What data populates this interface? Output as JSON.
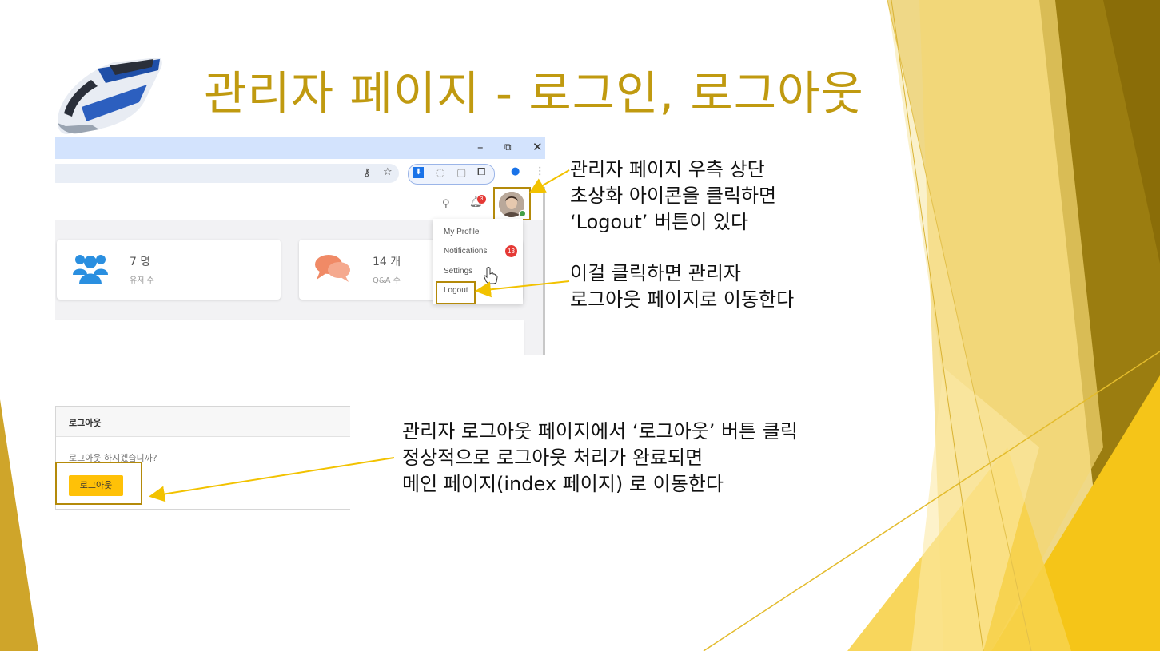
{
  "slide": {
    "title": "관리자 페이지 - 로그인, 로그아웃",
    "accent": "#c09a10"
  },
  "shot1": {
    "window_controls": {
      "minimize": "–",
      "restore": "⧉",
      "close": "✕"
    },
    "cards": [
      {
        "value": "7 명",
        "label": "유저 수",
        "icon": "users-icon",
        "color": "#2a8fe0"
      },
      {
        "value": "14 개",
        "label": "Q&A 수",
        "icon": "chat-bubbles-icon",
        "color": "#f08a66"
      }
    ],
    "bell_badge": "3",
    "dropdown": {
      "items": [
        "My Profile",
        "Notifications",
        "Settings",
        "Logout"
      ],
      "notifications_badge": "13"
    }
  },
  "shot2": {
    "header": "로그아웃",
    "message": "로그아웃 하시겠습니까?",
    "button": "로그아웃"
  },
  "notes": {
    "n1": [
      "관리자 페이지 우측 상단",
      "초상화 아이콘을 클릭하면",
      "‘Logout’ 버튼이 있다"
    ],
    "n2": [
      "이걸 클릭하면 관리자",
      "로그아웃 페이지로 이동한다"
    ],
    "n3": [
      "관리자 로그아웃 페이지에서 ‘로그아웃’ 버튼 클릭",
      "정상적으로 로그아웃 처리가 완료되면",
      "메인 페이지(index 페이지) 로 이동한다"
    ]
  }
}
